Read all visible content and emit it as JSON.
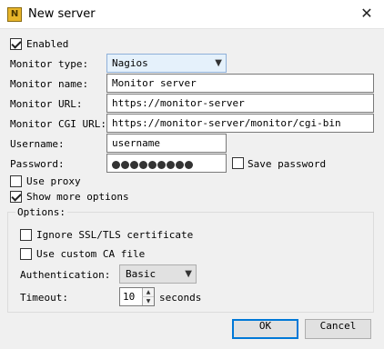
{
  "window": {
    "title": "New server",
    "icon_label": "N"
  },
  "enabled": {
    "label": "Enabled",
    "checked": true
  },
  "monitor_type": {
    "label": "Monitor type:",
    "value": "Nagios"
  },
  "monitor_name": {
    "label": "Monitor name:",
    "value": "Monitor server"
  },
  "monitor_url": {
    "label": "Monitor URL:",
    "value": "https://monitor-server"
  },
  "monitor_cgi_url": {
    "label": "Monitor CGI URL:",
    "value": "https://monitor-server/monitor/cgi-bin"
  },
  "username": {
    "label": "Username:",
    "value": "username"
  },
  "password": {
    "label": "Password:",
    "dots": 9
  },
  "save_password": {
    "label": "Save password",
    "checked": false
  },
  "use_proxy": {
    "label": "Use proxy",
    "checked": false
  },
  "show_more": {
    "label": "Show more options",
    "checked": true
  },
  "options": {
    "legend": "Options:",
    "ignore_ssl": {
      "label": "Ignore SSL/TLS certificate",
      "checked": false
    },
    "custom_ca": {
      "label": "Use custom CA file",
      "checked": false
    },
    "authentication": {
      "label": "Authentication:",
      "value": "Basic"
    },
    "timeout": {
      "label": "Timeout:",
      "value": "10",
      "unit": "seconds"
    }
  },
  "buttons": {
    "ok": "OK",
    "cancel": "Cancel"
  }
}
